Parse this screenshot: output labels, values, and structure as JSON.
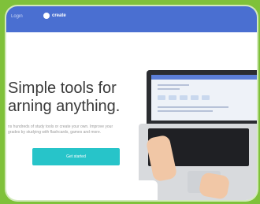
{
  "header": {
    "nav_left": "Login",
    "brand": "create"
  },
  "hero": {
    "headline_line1": "Simple tools for",
    "headline_line2": "arning anything.",
    "sub_line1": "ns hundreds of study tools or create your own. Improve your",
    "sub_line2": "grades by studying with flashcards, games and more.",
    "cta_label": "Get started"
  },
  "colors": {
    "page_background": "#7fc13a",
    "header": "#4a6fd1",
    "cta": "#27c4c9"
  }
}
